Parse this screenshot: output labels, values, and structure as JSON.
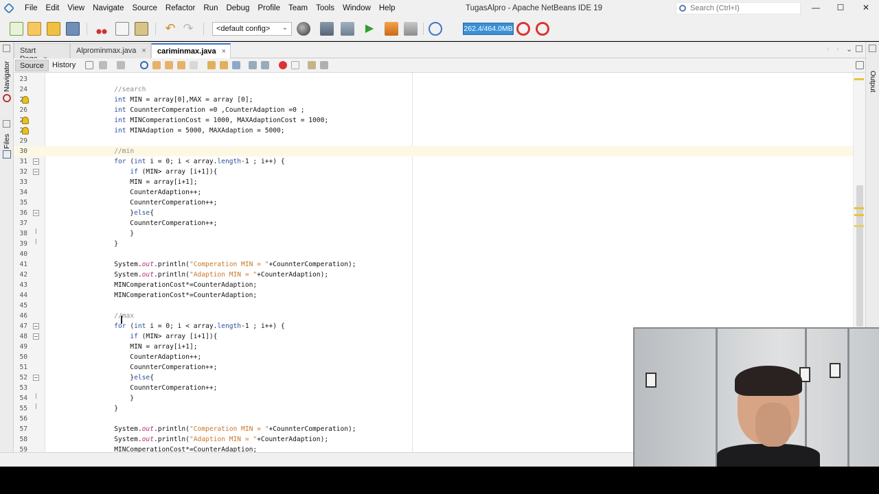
{
  "window": {
    "title": "TugasAlpro - Apache NetBeans IDE 19",
    "menu": [
      "File",
      "Edit",
      "View",
      "Navigate",
      "Source",
      "Refactor",
      "Run",
      "Debug",
      "Profile",
      "Team",
      "Tools",
      "Window",
      "Help"
    ],
    "search_placeholder": "Search (Ctrl+I)",
    "minimize": "—",
    "maximize": "☐",
    "close": "✕"
  },
  "toolbar": {
    "config_value": "<default config>",
    "config_arrow": "⌄",
    "memory": "262.4/464.0MB"
  },
  "tabs": [
    {
      "label": "Start Page",
      "active": false
    },
    {
      "label": "Alprominmax.java",
      "active": false
    },
    {
      "label": "cariminmax.java",
      "active": true
    }
  ],
  "tab_close": "×",
  "side": {
    "navigator": "Navigator",
    "files": "Files",
    "output": "Output"
  },
  "editor_tabs": {
    "source": "Source",
    "history": "History"
  },
  "code_lines": [
    {
      "n": "23",
      "t": ""
    },
    {
      "n": "24",
      "t": "        //search"
    },
    {
      "n": "25",
      "t": "        int MIN = array[0],MAX = array [0];"
    },
    {
      "n": "26",
      "t": "        int CounnterComperation =0 ,CounterAdaption =0 ;"
    },
    {
      "n": "27",
      "t": "        int MINComperationCost = 1000, MAXAdaptionCost = 1000;"
    },
    {
      "n": "28",
      "t": "        int MINAdaption = 5000, MAXAdaption = 5000;"
    },
    {
      "n": "29",
      "t": ""
    },
    {
      "n": "30",
      "t": "        //min"
    },
    {
      "n": "31",
      "t": "        for (int i = 0; i < array.length-1 ; i++) {"
    },
    {
      "n": "32",
      "t": "            if (MIN> array [i+1]){"
    },
    {
      "n": "33",
      "t": "            MIN = array[i+1];"
    },
    {
      "n": "34",
      "t": "            CounterAdaption++;"
    },
    {
      "n": "35",
      "t": "            CounnterComperation++;"
    },
    {
      "n": "36",
      "t": "            }else{"
    },
    {
      "n": "37",
      "t": "            CounnterComperation++;"
    },
    {
      "n": "38",
      "t": "            }"
    },
    {
      "n": "39",
      "t": "        }"
    },
    {
      "n": "40",
      "t": ""
    },
    {
      "n": "41",
      "t": "        System.out.println(\"Comperation MIN = \"+CounnterComperation);"
    },
    {
      "n": "42",
      "t": "        System.out.println(\"Adaption MIN = \"+CounterAdaption);"
    },
    {
      "n": "43",
      "t": "        MINComperationCost*=CounterAdaption;"
    },
    {
      "n": "44",
      "t": "        MINComperationCost*=CounterAdaption;"
    },
    {
      "n": "45",
      "t": ""
    },
    {
      "n": "46",
      "t": "        //max"
    },
    {
      "n": "47",
      "t": "        for (int i = 0; i < array.length-1 ; i++) {"
    },
    {
      "n": "48",
      "t": "            if (MIN> array [i+1]){"
    },
    {
      "n": "49",
      "t": "            MIN = array[i+1];"
    },
    {
      "n": "50",
      "t": "            CounterAdaption++;"
    },
    {
      "n": "51",
      "t": "            CounnterComperation++;"
    },
    {
      "n": "52",
      "t": "            }else{"
    },
    {
      "n": "53",
      "t": "            CounnterComperation++;"
    },
    {
      "n": "54",
      "t": "            }"
    },
    {
      "n": "55",
      "t": "        }"
    },
    {
      "n": "56",
      "t": ""
    },
    {
      "n": "57",
      "t": "        System.out.println(\"Comperation MIN = \"+CounnterComperation);"
    },
    {
      "n": "58",
      "t": "        System.out.println(\"Adaption MIN = \"+CounterAdaption);"
    },
    {
      "n": "59",
      "t": "        MINComperationCost*=CounterAdaption;"
    }
  ],
  "colors": {
    "keyword": "#2a4fa0",
    "comment": "#8c8c8c",
    "string": "#c8782a",
    "static_field": "#b22c74",
    "memory_bg": "#3a8fd6",
    "current_line": "#fcf8e4"
  }
}
